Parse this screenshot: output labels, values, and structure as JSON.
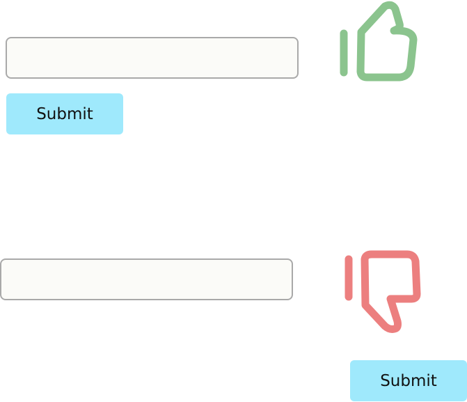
{
  "sections": [
    {
      "input": {
        "value": "",
        "placeholder": ""
      },
      "submit_label": "Submit",
      "icon": "thumbs-up-icon",
      "icon_color": "#8bc48e"
    },
    {
      "input": {
        "value": "",
        "placeholder": ""
      },
      "submit_label": "Submit",
      "icon": "thumbs-down-icon",
      "icon_color": "#ec7f7f"
    }
  ],
  "colors": {
    "button_bg": "#9fe9fc",
    "input_bg": "#fbfbf8",
    "input_border": "#a9a9a9"
  }
}
